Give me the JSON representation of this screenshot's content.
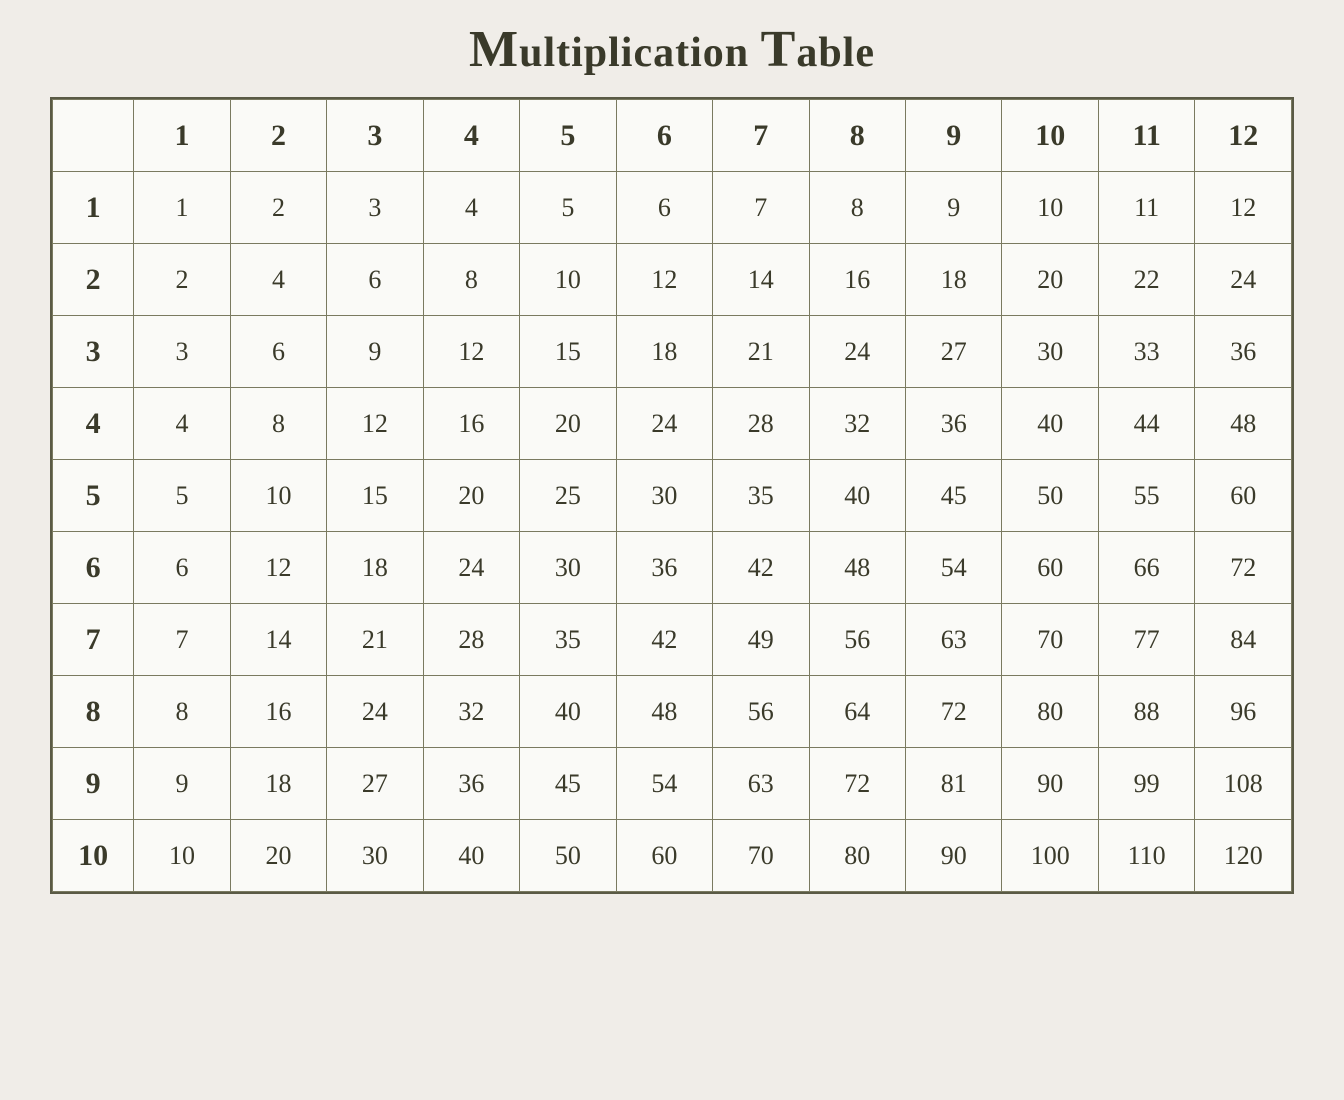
{
  "title": "Multiplication Table",
  "table": {
    "headers": [
      "",
      "1",
      "2",
      "3",
      "4",
      "5",
      "6",
      "7",
      "8",
      "9",
      "10",
      "11",
      "12"
    ],
    "rows": [
      {
        "header": "1",
        "values": [
          1,
          2,
          3,
          4,
          5,
          6,
          7,
          8,
          9,
          10,
          11,
          12
        ]
      },
      {
        "header": "2",
        "values": [
          2,
          4,
          6,
          8,
          10,
          12,
          14,
          16,
          18,
          20,
          22,
          24
        ]
      },
      {
        "header": "3",
        "values": [
          3,
          6,
          9,
          12,
          15,
          18,
          21,
          24,
          27,
          30,
          33,
          36
        ]
      },
      {
        "header": "4",
        "values": [
          4,
          8,
          12,
          16,
          20,
          24,
          28,
          32,
          36,
          40,
          44,
          48
        ]
      },
      {
        "header": "5",
        "values": [
          5,
          10,
          15,
          20,
          25,
          30,
          35,
          40,
          45,
          50,
          55,
          60
        ]
      },
      {
        "header": "6",
        "values": [
          6,
          12,
          18,
          24,
          30,
          36,
          42,
          48,
          54,
          60,
          66,
          72
        ]
      },
      {
        "header": "7",
        "values": [
          7,
          14,
          21,
          28,
          35,
          42,
          49,
          56,
          63,
          70,
          77,
          84
        ]
      },
      {
        "header": "8",
        "values": [
          8,
          16,
          24,
          32,
          40,
          48,
          56,
          64,
          72,
          80,
          88,
          96
        ]
      },
      {
        "header": "9",
        "values": [
          9,
          18,
          27,
          36,
          45,
          54,
          63,
          72,
          81,
          90,
          99,
          108
        ]
      },
      {
        "header": "10",
        "values": [
          10,
          20,
          30,
          40,
          50,
          60,
          70,
          80,
          90,
          100,
          110,
          120
        ]
      }
    ]
  }
}
